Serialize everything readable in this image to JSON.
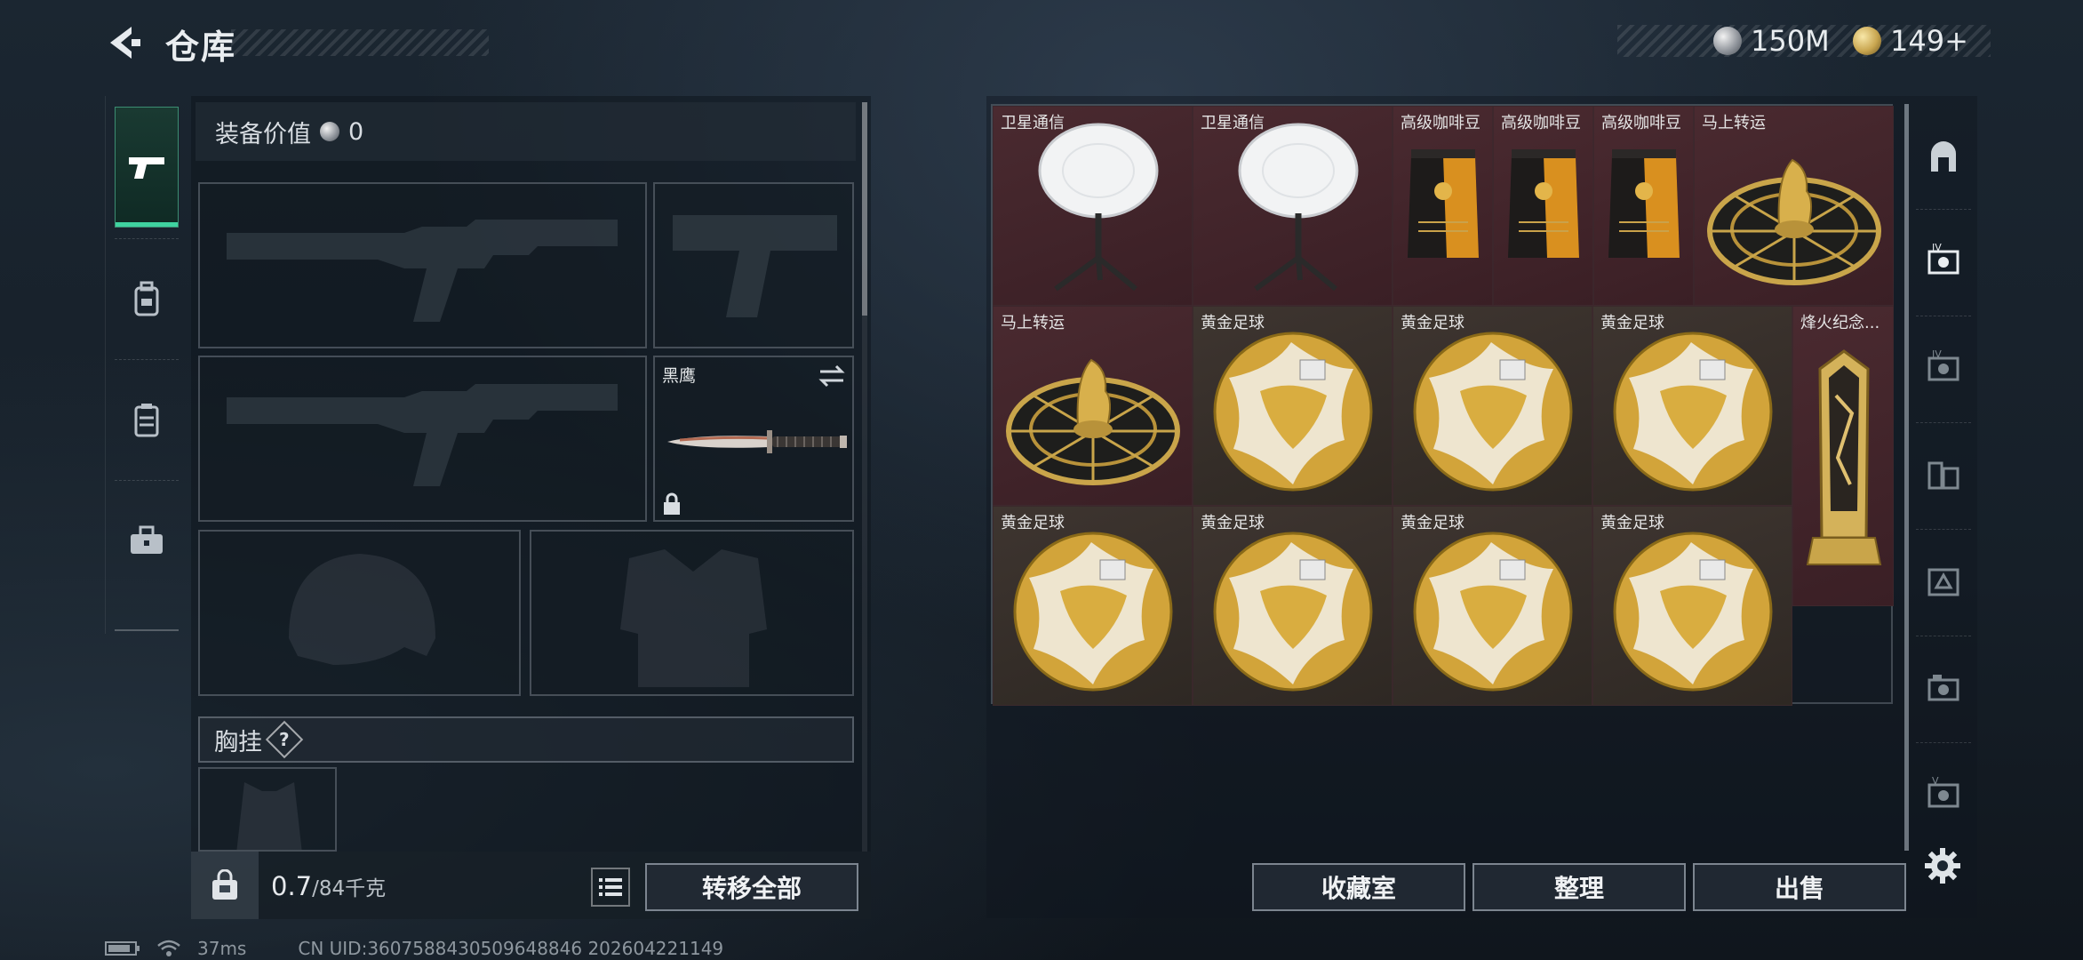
{
  "header": {
    "title": "仓库",
    "currencies": [
      {
        "icon": "silver-coin-icon",
        "value": "150M"
      },
      {
        "icon": "gold-coin-icon",
        "value": "149+"
      }
    ]
  },
  "left_nav": {
    "items": [
      {
        "name": "weapons",
        "icon": "pistol-icon",
        "active": true
      },
      {
        "name": "armor",
        "icon": "backpack-icon",
        "active": false
      },
      {
        "name": "container",
        "icon": "case-icon",
        "active": false
      },
      {
        "name": "tools",
        "icon": "toolbox-icon",
        "active": false
      }
    ]
  },
  "equipment": {
    "value_label": "装备价值",
    "value": "0",
    "slots": {
      "primary1": "rifle-silhouette",
      "pistol": "pistol-silhouette",
      "primary2": "rifle-silhouette",
      "melee": {
        "label": "黑鹰"
      },
      "helmet": "helmet-silhouette",
      "armor": "vest-silhouette"
    },
    "chest_rig_label": "胸挂",
    "chest_rig_help": "?"
  },
  "bottom_left": {
    "weight_current": "0.7",
    "weight_max": "/84千克",
    "transfer_all": "转移全部"
  },
  "storage": {
    "items": [
      {
        "name": "卫星通信",
        "kind": "satellite"
      },
      {
        "name": "卫星通信",
        "kind": "satellite"
      },
      {
        "name": "高级咖啡豆",
        "kind": "coffee"
      },
      {
        "name": "高级咖啡豆",
        "kind": "coffee"
      },
      {
        "name": "高级咖啡豆",
        "kind": "coffee"
      },
      {
        "name": "马上转运",
        "kind": "plate"
      },
      {
        "name": "马上转运",
        "kind": "plate"
      },
      {
        "name": "黄金足球",
        "kind": "ball"
      },
      {
        "name": "黄金足球",
        "kind": "ball"
      },
      {
        "name": "黄金足球",
        "kind": "ball"
      },
      {
        "name": "烽火纪念...",
        "kind": "trophy"
      },
      {
        "name": "黄金足球",
        "kind": "ball"
      },
      {
        "name": "黄金足球",
        "kind": "ball"
      },
      {
        "name": "黄金足球",
        "kind": "ball"
      },
      {
        "name": "黄金足球",
        "kind": "ball"
      }
    ]
  },
  "bottom_right": {
    "collection": "收藏室",
    "organize": "整理",
    "sell": "出售"
  },
  "right_tabs": [
    {
      "icon": "storage-home-icon"
    },
    {
      "icon": "storage-iv-icon"
    },
    {
      "icon": "storage-iv-2-icon"
    },
    {
      "icon": "storage-folder-icon"
    },
    {
      "icon": "storage-triangle-icon"
    },
    {
      "icon": "storage-camera-icon"
    },
    {
      "icon": "storage-v-icon"
    }
  ],
  "status_bar": {
    "ping": "37ms",
    "uid": "CN UID:3607588430509648846 202604221149"
  }
}
